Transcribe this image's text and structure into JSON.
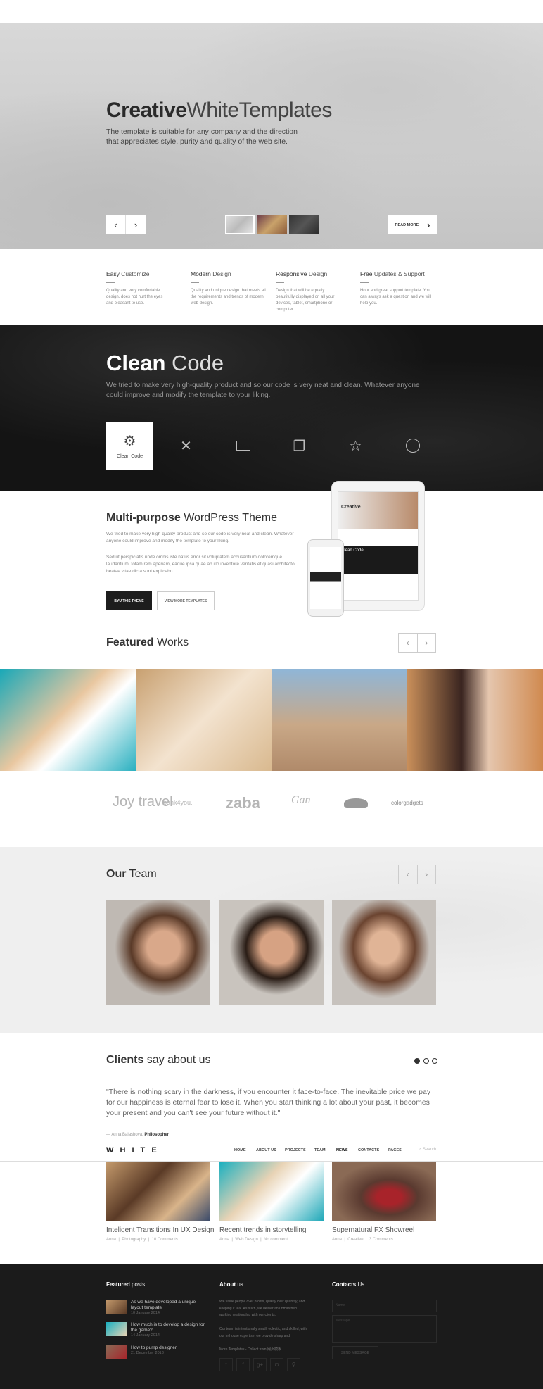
{
  "hero": {
    "title_bold": "Creative",
    "title_light": "WhiteTemplates",
    "subtitle_1": "The template is suitable for any company and the direction",
    "subtitle_2": "that appreciates style, purity and quality of the web site.",
    "prev": "‹",
    "next": "›",
    "read_more": "READ MORE",
    "read_more_arrow": "›"
  },
  "features": [
    {
      "bold": "Easy",
      "light": "Customize",
      "desc": "Quality and very comfortable design, does not hurt the eyes and pleasant to use."
    },
    {
      "bold": "Modern",
      "light": "Design",
      "desc": "Quality and unique design that meets all the requirements and trends of modern web design."
    },
    {
      "bold": "Responsive",
      "light": "Design",
      "desc": "Design that will be equally beautifully displayed on all your devices, tablet, smartphone or computer."
    },
    {
      "bold": "Free",
      "light": "Updates & Support",
      "desc": "Hour and great support template. You can always ask a question and we will help you."
    }
  ],
  "clean": {
    "title_bold": "Clean",
    "title_light": "Code",
    "desc": "We tried to make very high-quality product and so our code is very neat and clean. Whatever anyone could improve and modify the template to your liking.",
    "active_tab": "Clean Code",
    "tabs": [
      "gear-icon",
      "tools-icon",
      "monitor-icon",
      "documents-icon",
      "star-icon",
      "user-icon"
    ]
  },
  "multi": {
    "title_bold": "Multi-purpose",
    "title_light": "WordPress Theme",
    "p1": "We tried to make very high-quality product and so our code is very neat and clean. Whatever anyone could improve and modify the template to your liking.",
    "p2": "Sed ut perspiciatis unde omnis iste natus error sit voluptatem accusantium doloremque laudantium, totam rem aperiam, eaque ipsa quae ab illo inventore veritatis et quasi architecto beatae vitae dicta sunt explicabo.",
    "buy": "BYU THIS THEME",
    "view": "VIEW MORE TEMPLATES",
    "device_screen_title": "Creative",
    "device_screen_section": "Clean Code"
  },
  "works": {
    "title_bold": "Featured",
    "title_light": "Works",
    "prev": "‹",
    "next": "›"
  },
  "logos": [
    "Joy travel",
    "bank4you.",
    "zaba",
    "Gan",
    "",
    "colorgadgets"
  ],
  "team": {
    "title_bold": "Our",
    "title_light": "Team",
    "prev": "‹",
    "next": "›"
  },
  "clients": {
    "title_bold": "Clients",
    "title_light": "say about us",
    "quote": "\"There is nothing scary in the darkness, if you encounter it face-to-face. The inevitable price we pay for our happiness is eternal fear to lose it. When you start thinking a lot about your past, it becomes your present and you can't see your future without it.\"",
    "author": "— Anna Balashova,",
    "role": "Philosopher",
    "active_dot": 0
  },
  "nav": {
    "logo": "W H I T E",
    "items": [
      "HOME",
      "ABOUT US",
      "PROJECTS",
      "TEAM",
      "NEWS",
      "CONTACTS",
      "PAGES"
    ],
    "search_placeholder": "Search"
  },
  "blog": [
    {
      "title": "Inteligent Transitions In UX Design",
      "author": "Anna",
      "category": "Photography",
      "comments": "10 Comments"
    },
    {
      "title": "Recent trends in storytelling",
      "author": "Anna",
      "category": "Web Design",
      "comments": "No comment"
    },
    {
      "title": "Supernatural FX Showreel",
      "author": "Anna",
      "category": "Creative",
      "comments": "3 Comments"
    }
  ],
  "footer": {
    "featured_bold": "Featured",
    "featured_light": "posts",
    "posts": [
      {
        "title": "As we have developed a unique layout template",
        "date": "10 January 2014"
      },
      {
        "title": "How much is to develop a design for the game?",
        "date": "14 January 2014"
      },
      {
        "title": "How to pump designer",
        "date": "21 December 2013"
      }
    ],
    "about_bold": "About",
    "about_light": "us",
    "about_p1": "We value people over profits, quality over quantity, and keeping it real. As such, we deliver an unmatched working relationship with our clients.",
    "about_p2": "Our team is intentionally small, eclectic, and skilled; with our in-house expertise, we provide sharp and",
    "more": "More Templates - Collect from 网页模板",
    "social": [
      "twitter-icon",
      "facebook-icon",
      "google-plus-icon",
      "instagram-icon",
      "location-icon"
    ],
    "contacts_bold": "Contacts",
    "contacts_light": "Us",
    "name_placeholder": "Name",
    "message_placeholder": "Message",
    "send": "SEND MESSAGE"
  }
}
